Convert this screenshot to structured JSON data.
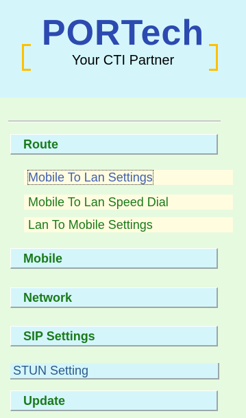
{
  "logo": {
    "brand": "PORTech",
    "tagline": "Your CTI Partner"
  },
  "menu": {
    "route": "Route",
    "route_items": [
      "Mobile To Lan Settings",
      "Mobile To Lan Speed Dial",
      "Lan To Mobile Settings"
    ],
    "mobile": "Mobile",
    "network": "Network",
    "sip": "SIP Settings",
    "stun": "STUN Setting",
    "update": "Update"
  },
  "colors": {
    "background": "#e6fadf",
    "button_bg": "#d4f6fb",
    "menu_text": "#1a7a1a",
    "brand_blue": "#2c4ab0",
    "bracket": "#ffc000"
  }
}
